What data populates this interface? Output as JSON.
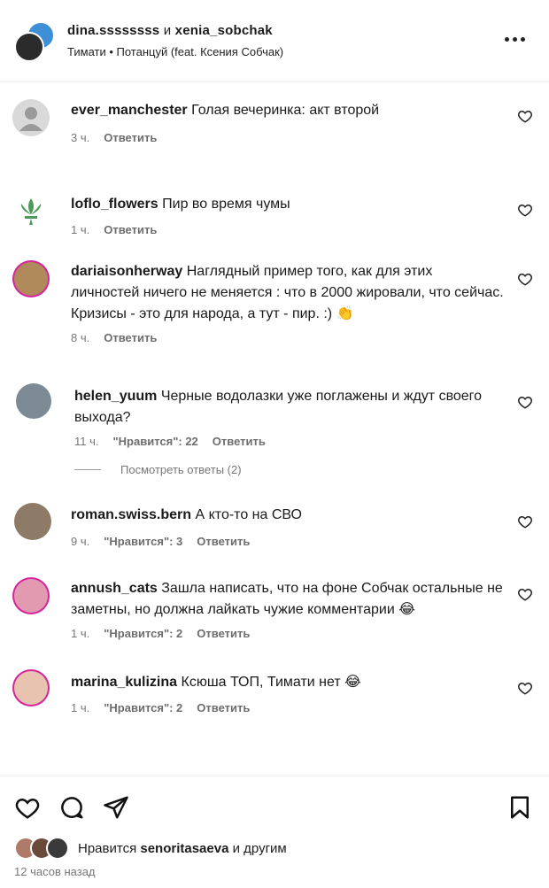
{
  "header": {
    "title_users": "dina.ssssssss",
    "title_joiner": " и ",
    "title_user2": "xenia_sobchak",
    "subtitle": "Тимати • Потанцуй (feat. Ксения Собчак)",
    "more_icon": "more-horizontal-icon"
  },
  "comments": [
    {
      "user": "ever_manchester",
      "text": "Голая вечеринка: акт второй",
      "time": "3 ч.",
      "likes": "",
      "reply": "Ответить",
      "avatar_color": "#d9d9d9"
    },
    {
      "user": "loflo_flowers",
      "text": "Пир во время чумы",
      "time": "1 ч.",
      "likes": "",
      "reply": "Ответить",
      "avatar_color": "#ffffff"
    },
    {
      "user": "dariaisonherway",
      "text": "Наглядный пример того, как для этих личностей ничего не меняется : что в 2000 жировали, что сейчас. Кризисы - это для народа, а тут - пир. :) 👏",
      "time": "8 ч.",
      "likes": "",
      "reply": "Ответить",
      "avatar_color": "#b08a5a"
    },
    {
      "user": "helen_yuum",
      "text": "Черные водолазки уже поглажены и ждут своего выхода?",
      "time": "11 ч.",
      "likes": "\"Нравится\": 22",
      "reply": "Ответить",
      "replies": "Посмотреть ответы (2)",
      "avatar_color": "#7c8a96"
    },
    {
      "user": "roman.swiss.bern",
      "text": "А кто-то на СВО",
      "time": "9 ч.",
      "likes": "\"Нравится\": 3",
      "reply": "Ответить",
      "avatar_color": "#8d7b68"
    },
    {
      "user": "annush_cats",
      "text": "Зашла написать, что на фоне Собчак остальные не заметны, но должна лайкать чужие комментарии 😂",
      "time": "1 ч.",
      "likes": "\"Нравится\": 2",
      "reply": "Ответить",
      "avatar_color": "#e29ab0"
    },
    {
      "user": "marina_kulizina",
      "text": "Ксюша ТОП, Тимати нет 😂",
      "time": "1 ч.",
      "likes": "\"Нравится\": 2",
      "reply": "Ответить",
      "avatar_color": "#e8c4b0"
    }
  ],
  "footer": {
    "likes_prefix": "Нравится ",
    "likes_user": "senoritasaeva",
    "likes_suffix": " и другим",
    "time": "12 часов назад"
  },
  "colors": {
    "ring": "#d6249f",
    "meta": "#777777"
  }
}
